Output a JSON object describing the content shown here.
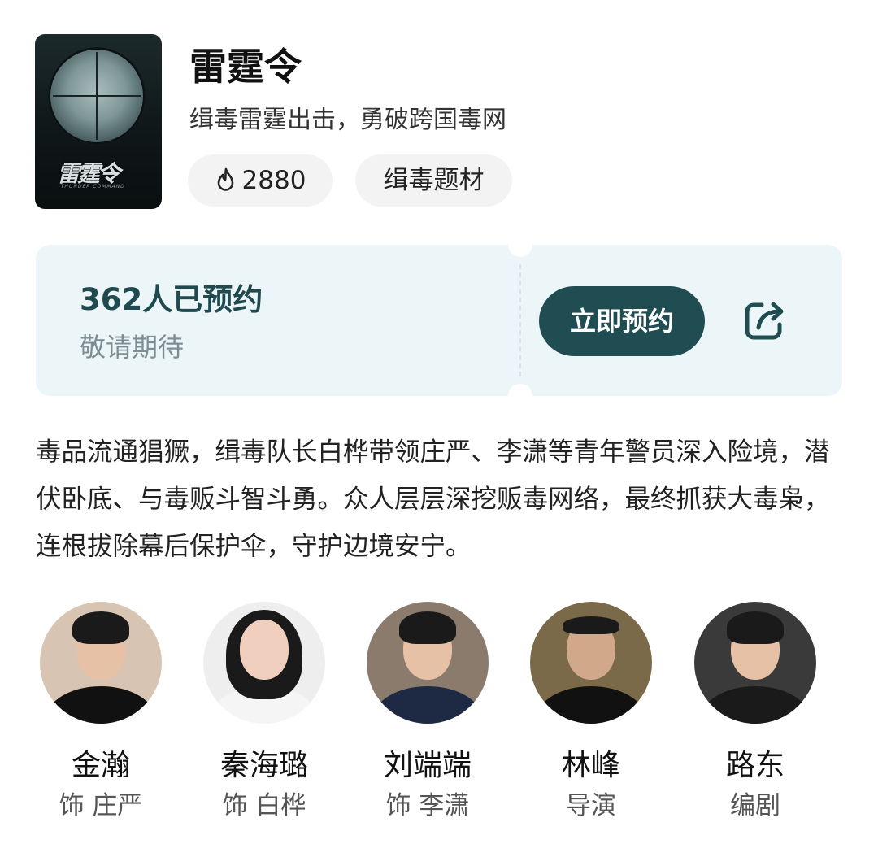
{
  "show": {
    "title": "雷霆令",
    "subtitle": "缉毒雷霆出击，勇破跨国毒网",
    "poster_logo": "雷霆令",
    "poster_logo_en": "THUNDER COMMAND",
    "heat": "2880",
    "genre_tag": "缉毒题材"
  },
  "reserve": {
    "count_text": "362人已预约",
    "status_text": "敬请期待",
    "button_label": "立即预约"
  },
  "description": "毒品流通猖獗，缉毒队长白桦带领庄严、李潇等青年警员深入险境，潜伏卧底、与毒贩斗智斗勇。众人层层深挖贩毒网络，最终抓获大毒枭，连根拔除幕后保护伞，守护边境安宁。",
  "cast": [
    {
      "name": "金瀚",
      "role": "饰 庄严"
    },
    {
      "name": "秦海璐",
      "role": "饰 白桦"
    },
    {
      "name": "刘端端",
      "role": "饰 李潇"
    },
    {
      "name": "林峰",
      "role": "导演"
    },
    {
      "name": "路东",
      "role": "编剧"
    }
  ],
  "icons": {
    "heat": "flame-icon",
    "share": "share-icon"
  },
  "colors": {
    "accent": "#1f4d52",
    "ticket_bg": "#ecf5f7",
    "tag_bg": "#f3f3f3"
  }
}
